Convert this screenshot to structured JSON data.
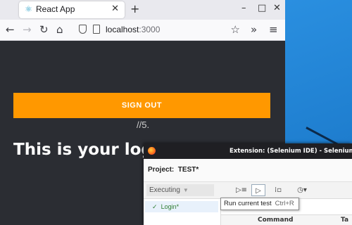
{
  "browser": {
    "tab_title": "React App",
    "favicon": "react-icon",
    "new_tab": "+",
    "url_host": "localhost",
    "url_port": ":3000",
    "window_controls": [
      "–",
      "□",
      "✕"
    ]
  },
  "app": {
    "signout_label": "SIGN OUT",
    "counter": "//5.",
    "heading": "This is your logg"
  },
  "selenium": {
    "window_title": "Extension: (Selenium IDE) - Selenium IDE - TE",
    "project_label": "Project:",
    "project_name": "TEST*",
    "executing_label": "Executing",
    "test_item": "Login*",
    "column_command": "Command",
    "column_target": "Ta",
    "tooltip_label": "Run current test",
    "tooltip_shortcut": "Ctrl+R"
  },
  "colors": {
    "accent": "#ff9800",
    "app_background": "#2b2d33",
    "desktop": "#1f7fd0"
  }
}
